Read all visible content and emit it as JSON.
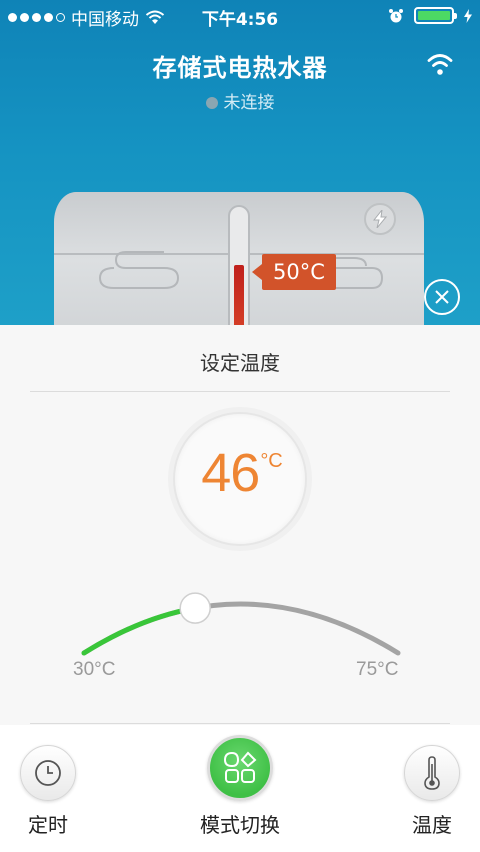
{
  "status_bar": {
    "carrier": "中国移动",
    "time": "下午4:56",
    "battery_color": "#4cd964"
  },
  "header": {
    "title": "存储式电热水器",
    "connection_status": "未连接",
    "wifi_icon": "wifi-icon"
  },
  "heater": {
    "current_temp": "50°C",
    "heating_icon": "lightning-bolt-icon",
    "close_icon": "close-icon"
  },
  "panel": {
    "title": "设定温度",
    "set_value": "46",
    "set_unit": "°C",
    "slider": {
      "min_label": "30°C",
      "max_label": "75°C",
      "min": 30,
      "max": 75,
      "value": 46,
      "active_color": "#39c639",
      "accent_color": "#ee8533"
    }
  },
  "nav": {
    "items": [
      {
        "label": "定时",
        "icon": "clock-icon"
      },
      {
        "label": "模式切换",
        "icon": "mode-grid-icon"
      },
      {
        "label": "温度",
        "icon": "thermometer-icon"
      }
    ]
  }
}
